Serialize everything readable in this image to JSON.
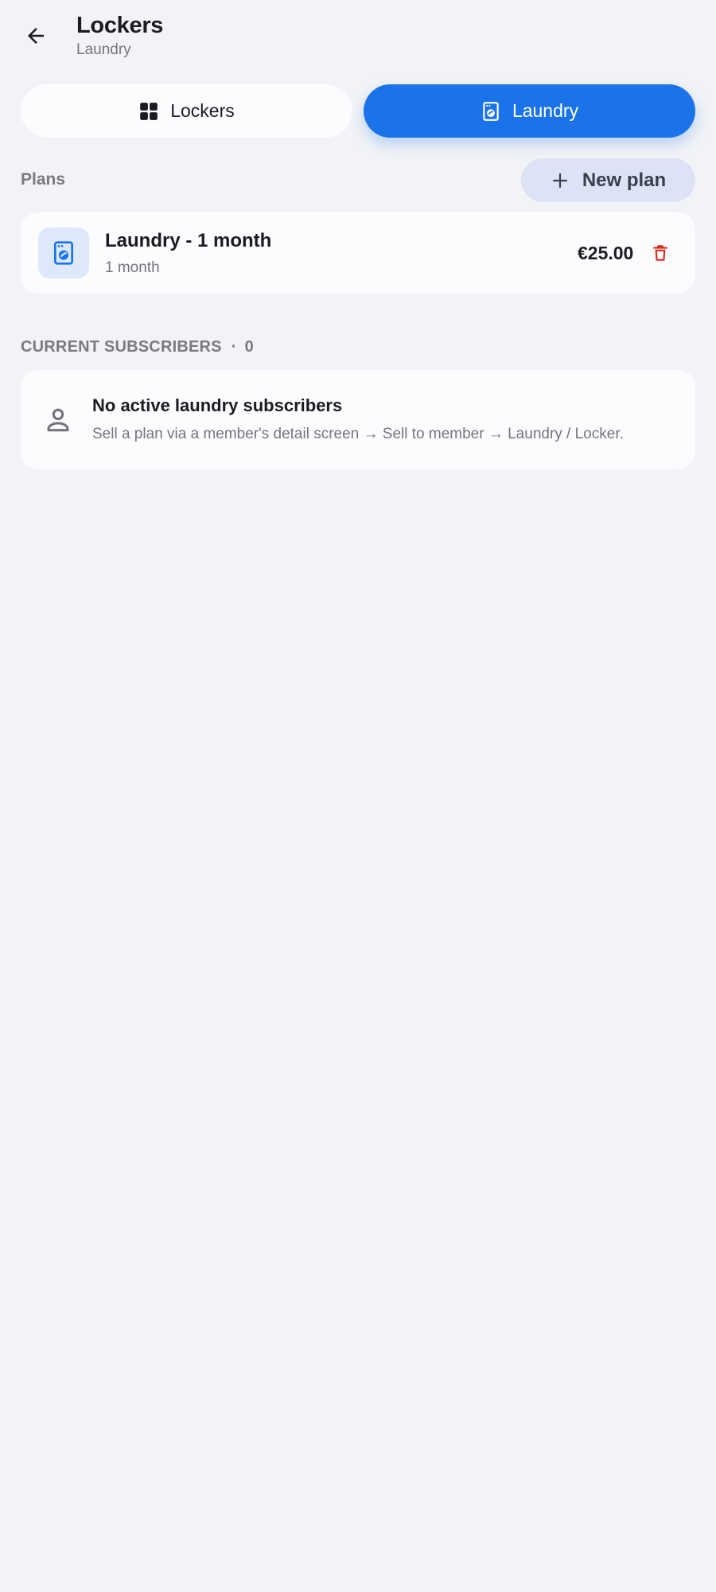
{
  "header": {
    "title": "Lockers",
    "subtitle": "Laundry"
  },
  "tabs": [
    {
      "label": "Lockers",
      "icon": "grid-icon",
      "selected": false
    },
    {
      "label": "Laundry",
      "icon": "washing-machine-icon",
      "selected": true
    }
  ],
  "plans": {
    "label": "Plans",
    "new_plan_label": "New plan",
    "items": [
      {
        "name": "Laundry - 1 month",
        "duration": "1 month",
        "price": "€25.00",
        "icon": "washing-machine-icon"
      }
    ]
  },
  "subscribers": {
    "header": "CURRENT SUBSCRIBERS",
    "separator": "·",
    "count": "0",
    "empty_title": "No active laundry subscribers",
    "empty_description": "Sell a plan via a member's detail screen → Sell to member → Laundry / Locker."
  },
  "colors": {
    "accent": "#1a73e8",
    "background": "#f2f3f6",
    "card": "#fbfcfe",
    "danger": "#d93025",
    "new_plan_bg": "#dde3f5"
  }
}
